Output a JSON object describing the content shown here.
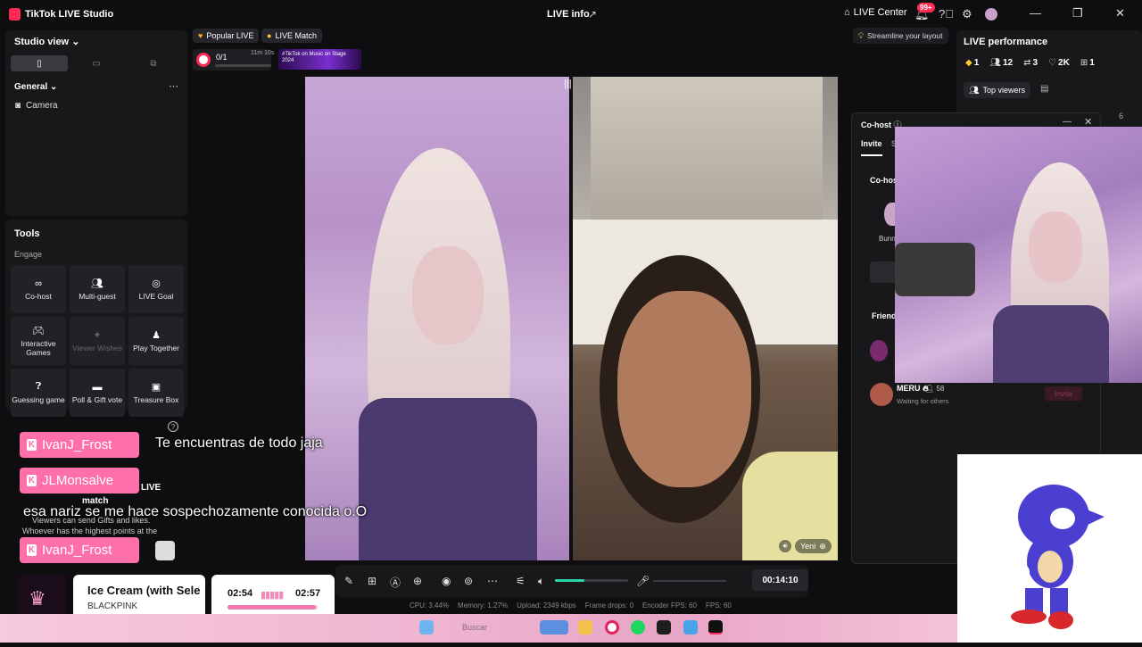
{
  "titlebar": {
    "app_title": "TikTok LIVE Studio",
    "center_title": "LIVE info",
    "live_center": "LIVE Center",
    "notif_badge": "99+"
  },
  "studio": {
    "title": "Studio view",
    "section": "General",
    "source": "Camera"
  },
  "tools": {
    "title": "Tools",
    "category": "Engage",
    "items": [
      {
        "label": "Co-host",
        "icon": "link-icon"
      },
      {
        "label": "Multi-guest",
        "icon": "users-icon"
      },
      {
        "label": "LIVE Goal",
        "icon": "target-icon"
      },
      {
        "label": "Interactive Games",
        "icon": "gamepad-icon"
      },
      {
        "label": "Viewer Wishes",
        "icon": "wishes-icon"
      },
      {
        "label": "Play Together",
        "icon": "person-icon"
      },
      {
        "label": "Guessing game",
        "icon": "question-icon"
      },
      {
        "label": "Poll & Gift vote",
        "icon": "poll-icon"
      },
      {
        "label": "Treasure Box",
        "icon": "box-icon"
      }
    ]
  },
  "scene": {
    "chip_popular": "Popular LIVE",
    "chip_match": "LIVE Match",
    "match_value": "0/1",
    "match_time": "11m 10s",
    "banner_text": "#TikTok on Music on Stage 2024",
    "guest_name": "Yeni"
  },
  "chat": {
    "messages": [
      {
        "user": "IvanJ_Frost",
        "text": "Te encuentras de todo jaja"
      },
      {
        "user": "JLMonsalve",
        "text": ""
      },
      {
        "user": "",
        "text": "esa nariz se me hace sospechozamente conocida o.O"
      },
      {
        "user": "IvanJ_Frost",
        "text": ""
      }
    ],
    "live_label": "LIVE",
    "match_label": "match",
    "info_line1": "Viewers can send Gifts and likes.",
    "info_line2": "Whoever has the highest points at the"
  },
  "music": {
    "song": "Ice Cream (with Selena Gomez)",
    "artist": "BLACKPINK",
    "elapsed": "02:54",
    "total": "02:57",
    "progress": 0.98
  },
  "controls": {
    "duration": "00:14:10",
    "volume": 0.4,
    "stats": {
      "cpu": "CPU: 3.44%",
      "memory": "Memory: 1.27%",
      "upload": "Upload: 2349 kbps",
      "frame_drops": "Frame drops: 0",
      "encoder_fps": "Encoder FPS: 60",
      "fps": "FPS: 60"
    }
  },
  "performance": {
    "streamline": "Streamline your layout",
    "title": "LIVE performance",
    "stats": [
      {
        "icon": "diamond-icon",
        "value": "1"
      },
      {
        "icon": "viewers-icon",
        "value": "12"
      },
      {
        "icon": "share-icon",
        "value": "3"
      },
      {
        "icon": "heart-icon",
        "value": "2K"
      },
      {
        "icon": "gift-icon",
        "value": "1"
      }
    ],
    "top_viewers": "Top viewers",
    "side_number": "6"
  },
  "cohost": {
    "title": "Co-host",
    "tab_invite": "Invite",
    "tab_second": "S",
    "section": "Co-hos",
    "avatar_name": "Bunn",
    "friends": "Friend",
    "friend_name": "MERU",
    "friend_count": "58",
    "friend_status": "Waiting for others",
    "invite_label": "Invite"
  },
  "taskbar": {
    "search": "Buscar"
  },
  "colors": {
    "accent": "#fe2c55",
    "chat_pill": "#ff6faa",
    "volume": "#29d6a7"
  }
}
